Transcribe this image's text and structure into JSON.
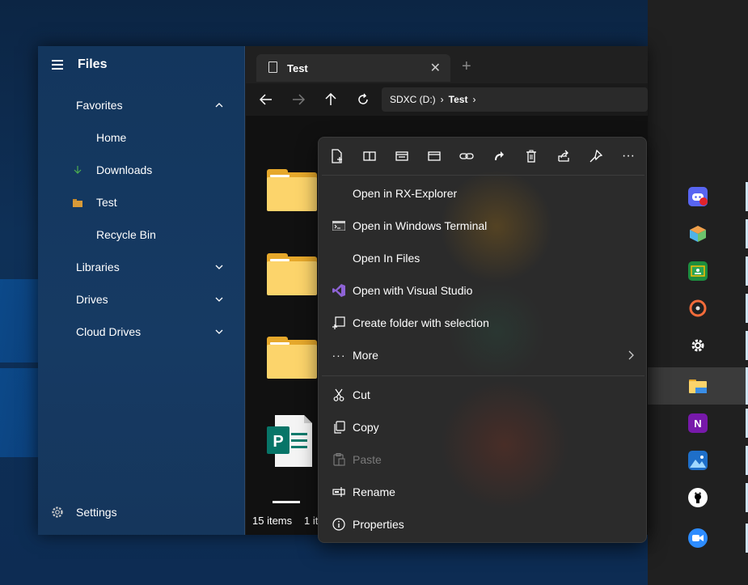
{
  "app": {
    "title": "Files"
  },
  "sidebar": {
    "items": [
      {
        "label": "Favorites",
        "expanded": true
      },
      {
        "label": "Home"
      },
      {
        "label": "Downloads"
      },
      {
        "label": "Test"
      },
      {
        "label": "Recycle Bin"
      },
      {
        "label": "Libraries"
      },
      {
        "label": "Drives"
      },
      {
        "label": "Cloud Drives"
      }
    ],
    "settings_label": "Settings"
  },
  "tabs": [
    {
      "label": "Test"
    }
  ],
  "toolbar": {
    "breadcrumb": [
      "SDXC (D:)",
      "Test"
    ]
  },
  "status": {
    "items": "15 items",
    "selected": "1 it"
  },
  "context_menu": {
    "items": [
      {
        "label": "Open in RX-Explorer"
      },
      {
        "label": "Open in Windows Terminal"
      },
      {
        "label": "Open In Files"
      },
      {
        "label": "Open with Visual Studio"
      },
      {
        "label": "Create folder with selection"
      },
      {
        "label": "More"
      },
      {
        "label": "Cut"
      },
      {
        "label": "Copy"
      },
      {
        "label": "Paste",
        "disabled": true
      },
      {
        "label": "Rename"
      },
      {
        "label": "Properties"
      }
    ]
  },
  "colors": {
    "sidebar_bg": "#13365d",
    "menu_bg": "#2b2b2b",
    "folder": "#fcd46b",
    "taskbar": "#202020",
    "accent_vs": "#8e63d6"
  }
}
